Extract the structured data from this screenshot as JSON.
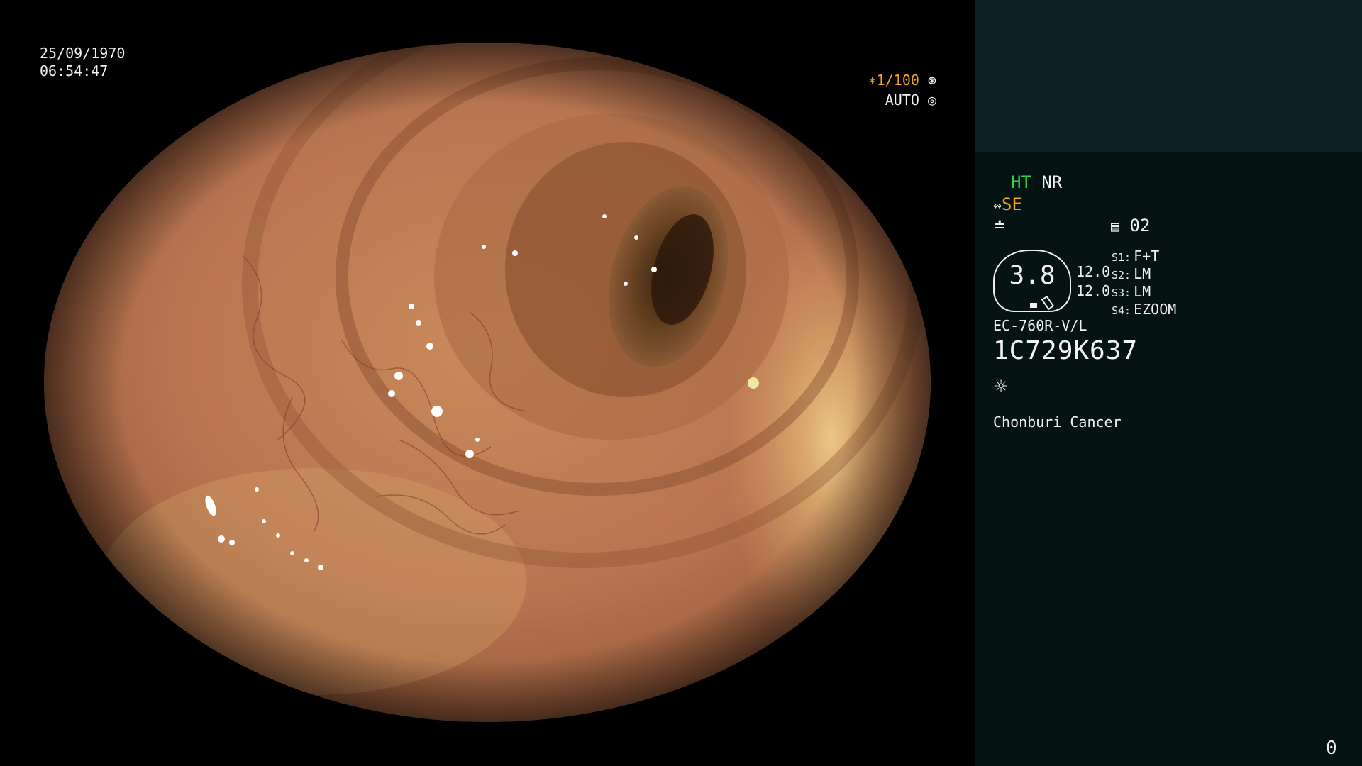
{
  "overlay": {
    "date": "25/09/1970",
    "time": "06:54:47",
    "shutter": "∗1/100",
    "shutter_icon": "aperture-icon",
    "iris_mode": "AUTO",
    "iris_icon": "iris-icon"
  },
  "panel": {
    "ht_label": "HT",
    "nr_label": "NR",
    "se_label": "SE",
    "memory_icon": "memory-card-icon",
    "memory_value": "02",
    "gauge_value": "3.8",
    "level_top": "12.0",
    "level_bottom": "12.0",
    "modes": [
      {
        "key": "S1:",
        "value": "F+T"
      },
      {
        "key": "S2:",
        "value": "LM"
      },
      {
        "key": "S3:",
        "value": "LM"
      },
      {
        "key": "S4:",
        "value": "EZOOM"
      }
    ],
    "scope_model": "EC-760R-V/L",
    "serial_number": "1C729K637",
    "light_icon": "sun-icon",
    "clinic_name": "Chonburi Cancer",
    "counter": "0"
  },
  "colors": {
    "panel_top": "#0c2425",
    "panel_bottom": "#051312",
    "ht_green": "#33d04a",
    "se_orange": "#f0a020",
    "shutter_orange": "#f5a623"
  }
}
